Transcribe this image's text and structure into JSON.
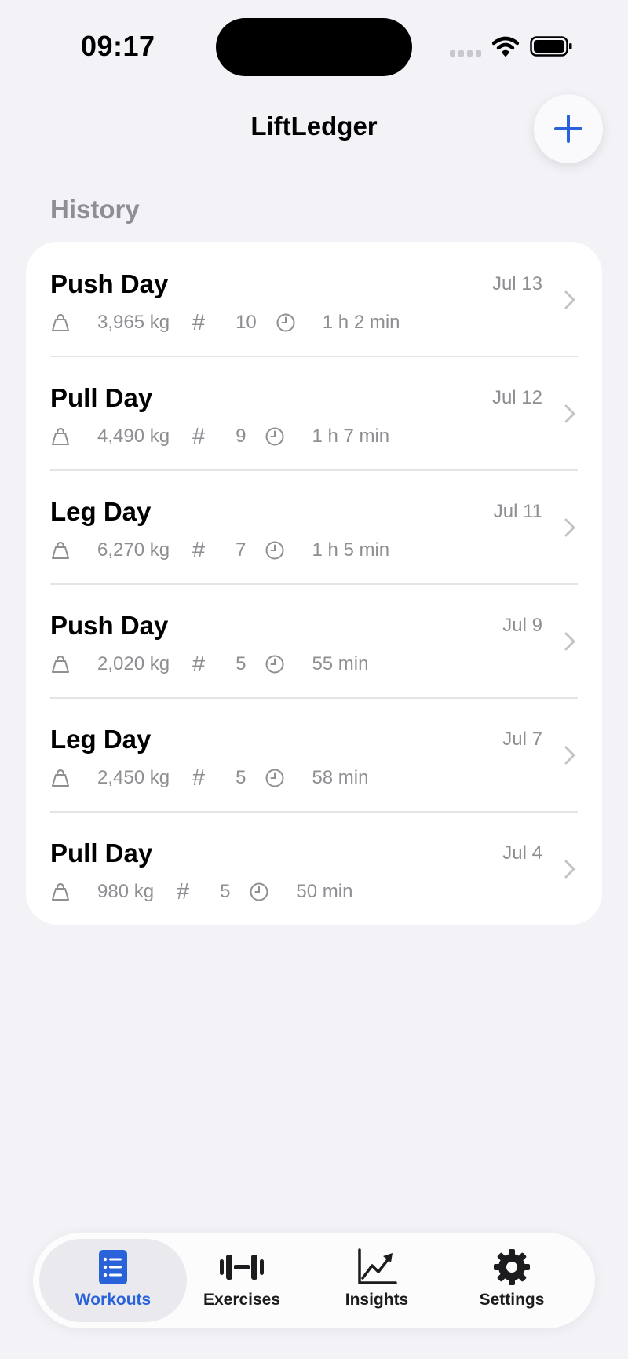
{
  "status_bar": {
    "time": "09:17"
  },
  "header": {
    "title": "LiftLedger",
    "add_button_icon": "plus-icon"
  },
  "history": {
    "section_title": "History",
    "workouts": [
      {
        "name": "Push Day",
        "date": "Jul 13",
        "volume": "3,965 kg",
        "sets": "10",
        "duration": "1 h 2 min"
      },
      {
        "name": "Pull Day",
        "date": "Jul 12",
        "volume": "4,490 kg",
        "sets": "9",
        "duration": "1 h 7 min"
      },
      {
        "name": "Leg Day",
        "date": "Jul 11",
        "volume": "6,270 kg",
        "sets": "7",
        "duration": "1 h 5 min"
      },
      {
        "name": "Push Day",
        "date": "Jul 9",
        "volume": "2,020 kg",
        "sets": "5",
        "duration": "55 min"
      },
      {
        "name": "Leg Day",
        "date": "Jul 7",
        "volume": "2,450 kg",
        "sets": "5",
        "duration": "58 min"
      },
      {
        "name": "Pull Day",
        "date": "Jul 4",
        "volume": "980 kg",
        "sets": "5",
        "duration": "50 min"
      }
    ]
  },
  "tab_bar": {
    "tabs": [
      {
        "label": "Workouts",
        "icon": "list-icon",
        "active": true
      },
      {
        "label": "Exercises",
        "icon": "dumbbell-icon",
        "active": false
      },
      {
        "label": "Insights",
        "icon": "chart-icon",
        "active": false
      },
      {
        "label": "Settings",
        "icon": "gear-icon",
        "active": false
      }
    ]
  },
  "colors": {
    "accent": "#2962d9",
    "background": "#f2f2f7",
    "secondary_text": "#8e8e93"
  }
}
